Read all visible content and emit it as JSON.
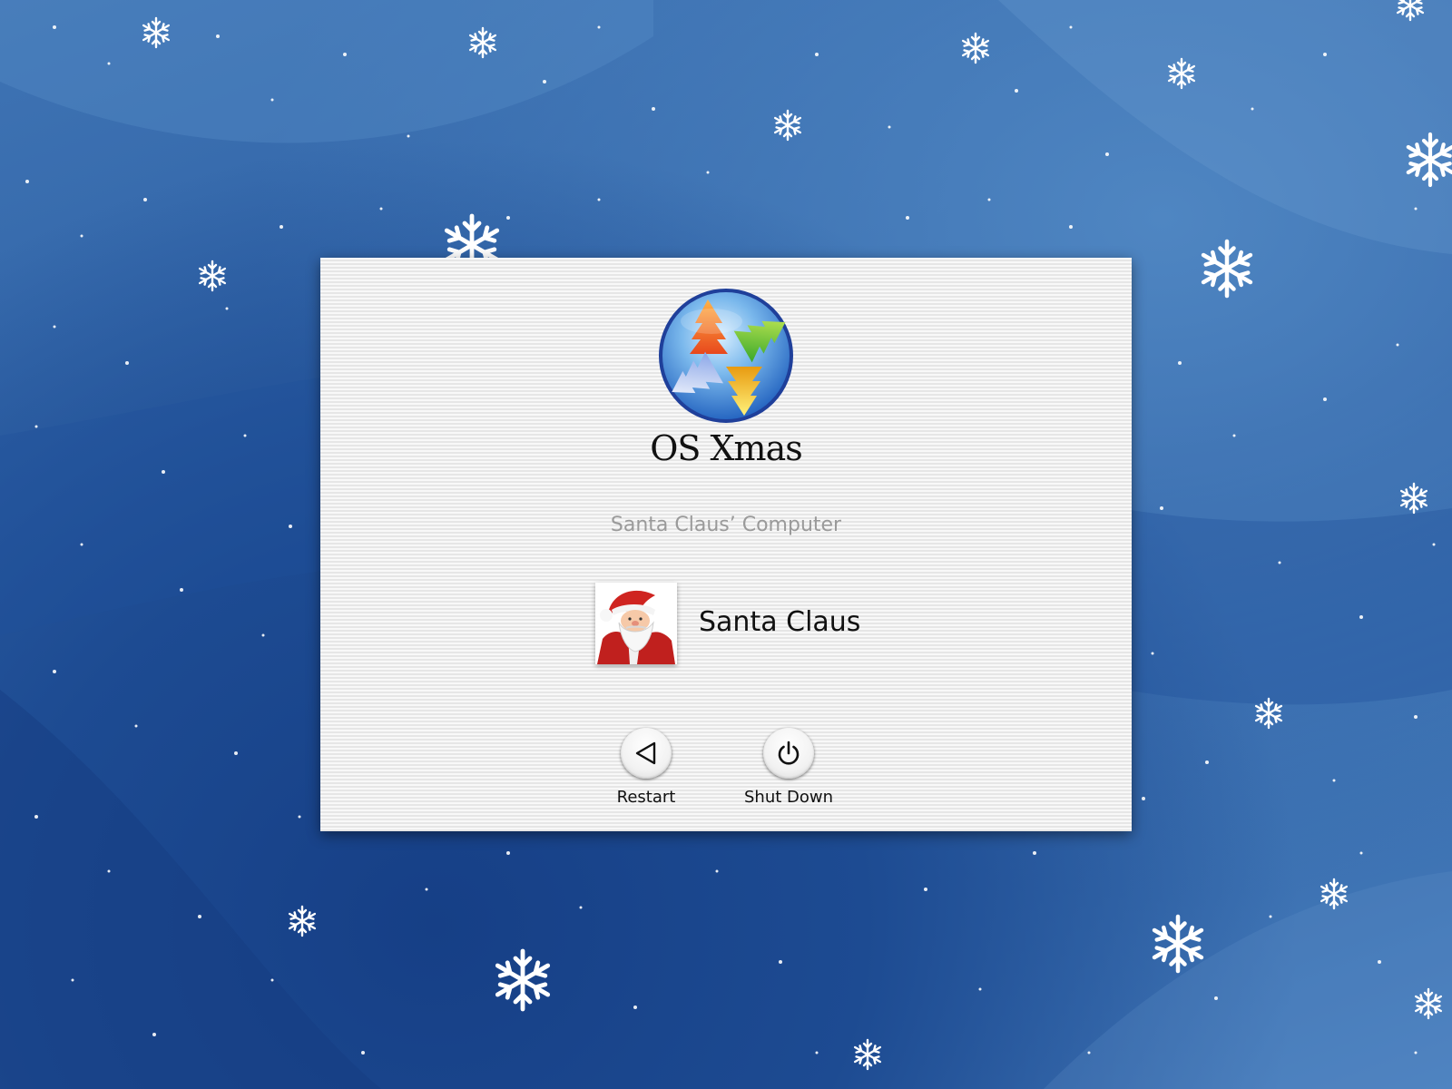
{
  "os": {
    "name": "OS Xmas",
    "logo_icon": "christmas-tree-globe-icon"
  },
  "computer": {
    "name": "Santa Claus’ Computer"
  },
  "user": {
    "name": "Santa Claus",
    "avatar_icon": "santa-avatar-icon"
  },
  "actions": {
    "restart_label": "Restart",
    "restart_icon": "restart-triangle-icon",
    "shutdown_label": "Shut Down",
    "shutdown_icon": "power-icon"
  },
  "theme": {
    "desktop_blue": "#2f62a6",
    "panel_bg": "#f4f4f4",
    "computer_name_color": "#9a9a9a"
  }
}
